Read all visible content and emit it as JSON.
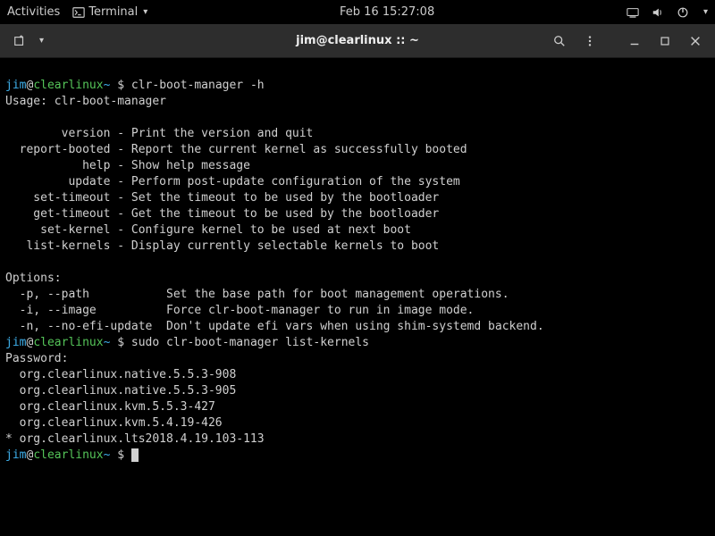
{
  "topbar": {
    "activities": "Activities",
    "app_label": "Terminal",
    "clock": "Feb 16  15:27:08"
  },
  "titlebar": {
    "title": "jim@clearlinux :: ~"
  },
  "prompt": {
    "user": "jim",
    "at": "@",
    "host": "clearlinux",
    "tilde": "~",
    "dollar": " $ "
  },
  "lines": {
    "c1": "clr-boot-manager -h",
    "l1": "Usage: clr-boot-manager",
    "l2": "        version - Print the version and quit",
    "l3": "  report-booted - Report the current kernel as successfully booted",
    "l4": "           help - Show help message",
    "l5": "         update - Perform post-update configuration of the system",
    "l6": "    set-timeout - Set the timeout to be used by the bootloader",
    "l7": "    get-timeout - Get the timeout to be used by the bootloader",
    "l8": "     set-kernel - Configure kernel to be used at next boot",
    "l9": "   list-kernels - Display currently selectable kernels to boot",
    "l10": "Options:",
    "l11": "  -p, --path           Set the base path for boot management operations.",
    "l12": "  -i, --image          Force clr-boot-manager to run in image mode.",
    "l13": "  -n, --no-efi-update  Don't update efi vars when using shim-systemd backend.",
    "c2": "sudo clr-boot-manager list-kernels",
    "l14": "Password:",
    "l15": "  org.clearlinux.native.5.5.3-908",
    "l16": "  org.clearlinux.native.5.5.3-905",
    "l17": "  org.clearlinux.kvm.5.5.3-427",
    "l18": "  org.clearlinux.kvm.5.4.19-426",
    "l19": "* org.clearlinux.lts2018.4.19.103-113"
  }
}
